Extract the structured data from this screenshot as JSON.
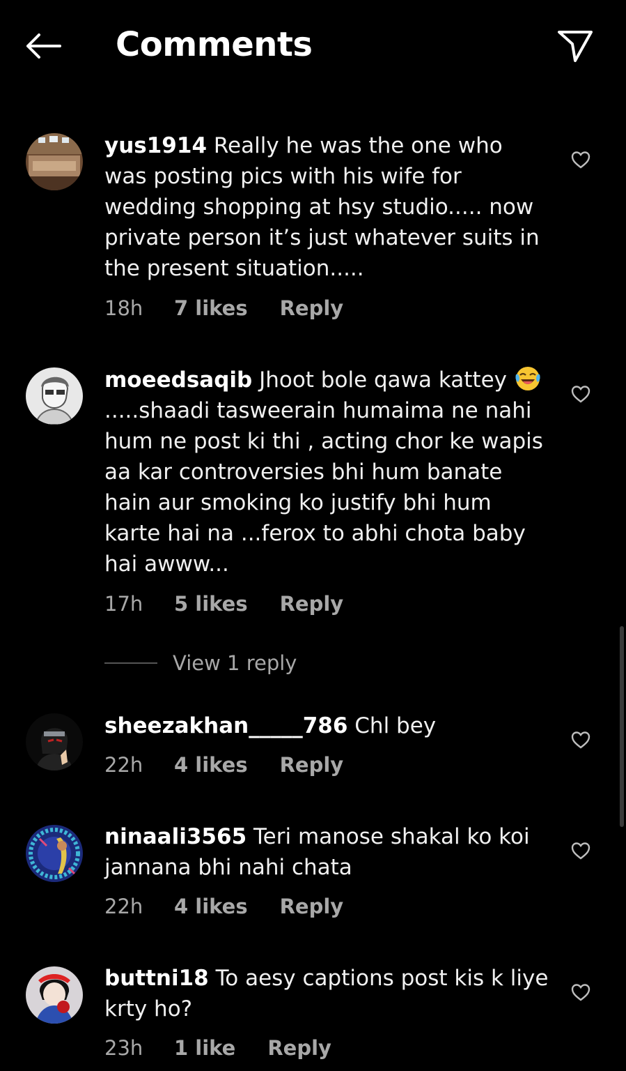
{
  "header": {
    "title": "Comments",
    "back_icon": "arrow-left-icon",
    "share_icon": "paper-plane-icon"
  },
  "comments": [
    {
      "username": "yus1914",
      "text": "Really he was the one who was posting pics with his wife for wedding shopping at hsy studio..... now private person it’s just whatever suits in the present situation.....",
      "time": "18h",
      "likes": "7 likes",
      "reply": "Reply"
    },
    {
      "username": "moeedsaqib",
      "text_before_emoji": "Jhoot bole qawa kattey",
      "emoji": "😂",
      "text_after_emoji": ".....shaadi tasweerain humaima ne nahi hum ne post ki thi , acting chor ke wapis aa kar controversies bhi hum banate hain aur smoking ko justify bhi hum karte hai na ...ferox to abhi chota baby hai awww...",
      "time": "17h",
      "likes": "5 likes",
      "reply": "Reply",
      "view_replies": "View 1 reply"
    },
    {
      "username": "sheezakhan_____786",
      "text": "Chl bey",
      "time": "22h",
      "likes": "4 likes",
      "reply": "Reply"
    },
    {
      "username": "ninaali3565",
      "text": "Teri manose shakal ko koi jannana bhi nahi chata",
      "time": "22h",
      "likes": "4 likes",
      "reply": "Reply"
    },
    {
      "username": "buttni18",
      "text": "To aesy captions post kis k liye krty ho?",
      "time": "23h",
      "likes": "1 like",
      "reply": "Reply"
    }
  ]
}
